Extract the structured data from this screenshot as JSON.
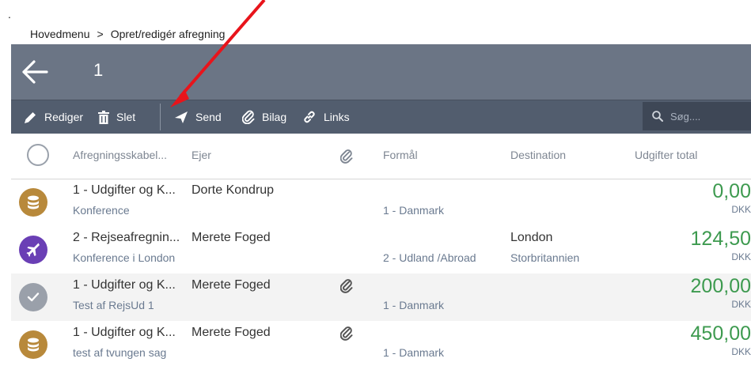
{
  "page_dot": ".",
  "breadcrumb": {
    "home": "Hovedmenu",
    "sep": ">",
    "current": "Opret/redigér afregning"
  },
  "titlebar": {
    "title": "1"
  },
  "toolbar": {
    "edit": "Rediger",
    "delete": "Slet",
    "send": "Send",
    "attach": "Bilag",
    "links": "Links",
    "search_placeholder": "Søg...."
  },
  "columns": {
    "template": "Afregningsskabel...",
    "owner": "Ejer",
    "purpose": "Formål",
    "destination": "Destination",
    "total": "Udgifter total"
  },
  "rows": [
    {
      "icon": "database-icon",
      "color": "#b8893b",
      "title": "1 - Udgifter og K...",
      "owner": "Dorte Kondrup",
      "subtitle": "Konference",
      "attachment": false,
      "purpose": "1 - Danmark",
      "destination": "",
      "destination_country": "",
      "amount": "0,00",
      "currency": "DKK"
    },
    {
      "icon": "airplane-icon",
      "color": "#6a3fb5",
      "title": "2 - Rejseafregnin...",
      "owner": "Merete Foged",
      "subtitle": "Konference i London",
      "attachment": false,
      "purpose": "2 - Udland /Abroad",
      "destination": "London",
      "destination_country": "Storbritannien",
      "amount": "124,50",
      "currency": "DKK"
    },
    {
      "icon": "check-icon",
      "color": "#9aa0aa",
      "title": "1 - Udgifter og K...",
      "owner": "Merete Foged",
      "subtitle": "Test af RejsUd 1",
      "attachment": true,
      "purpose": "1 - Danmark",
      "destination": "",
      "destination_country": "",
      "amount": "200,00",
      "currency": "DKK"
    },
    {
      "icon": "database-icon",
      "color": "#b8893b",
      "title": "1 - Udgifter og K...",
      "owner": "Merete Foged",
      "subtitle": "test af tvungen sag",
      "attachment": true,
      "purpose": "1 - Danmark",
      "destination": "",
      "destination_country": "",
      "amount": "450,00",
      "currency": "DKK"
    }
  ],
  "colors": {
    "titlebar": "#6b7585",
    "toolbar": "#525d6e",
    "amount": "#3d9a4f",
    "annotation_arrow": "#e8141b"
  }
}
